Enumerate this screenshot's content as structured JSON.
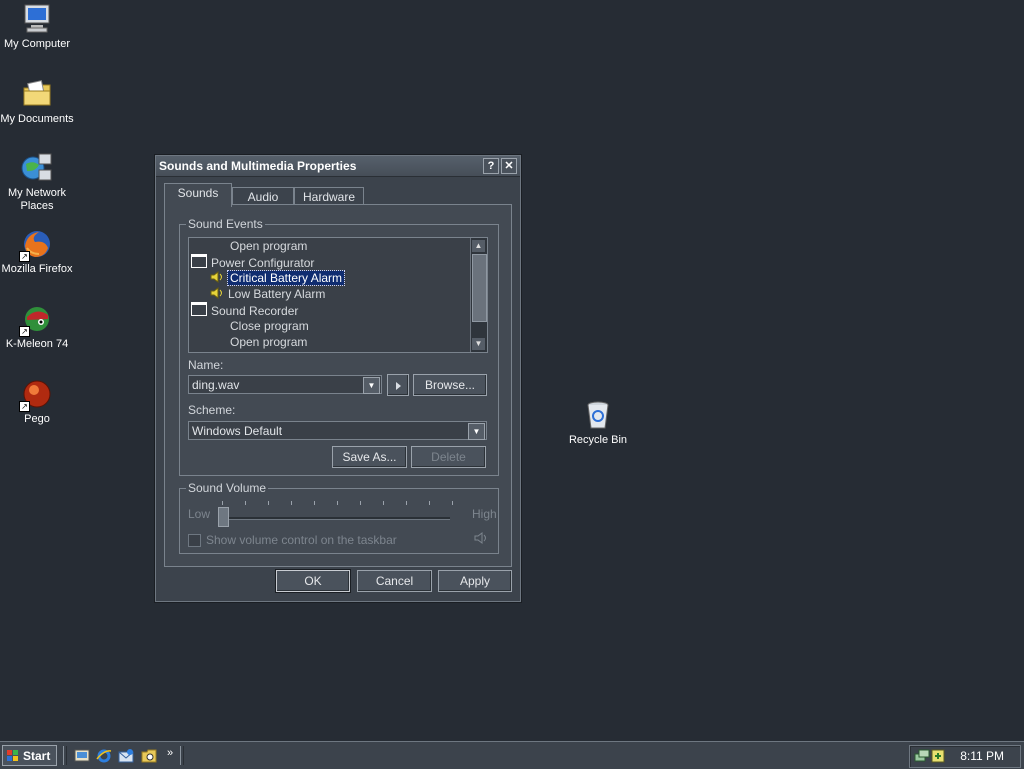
{
  "desktop": {
    "icons": [
      {
        "label": "My Computer"
      },
      {
        "label": "My Documents"
      },
      {
        "label": "My Network Places"
      },
      {
        "label": "Mozilla Firefox"
      },
      {
        "label": "K-Meleon 74"
      },
      {
        "label": "Pego"
      },
      {
        "label": "Recycle Bin"
      }
    ]
  },
  "dialog": {
    "title": "Sounds and Multimedia Properties",
    "help_glyph": "?",
    "close_glyph": "✕",
    "tabs": [
      "Sounds",
      "Audio",
      "Hardware"
    ],
    "active_tab": "Sounds",
    "sound_events": {
      "legend": "Sound Events",
      "items": [
        {
          "label": "Open program",
          "level": 1,
          "icon": "none"
        },
        {
          "label": "Power Configurator",
          "level": 0,
          "icon": "window-icon"
        },
        {
          "label": "Critical Battery Alarm",
          "level": 1,
          "icon": "speaker-icon",
          "selected": true
        },
        {
          "label": "Low Battery Alarm",
          "level": 1,
          "icon": "speaker-icon"
        },
        {
          "label": "Sound Recorder",
          "level": 0,
          "icon": "window-icon"
        },
        {
          "label": "Close program",
          "level": 1,
          "icon": "none"
        },
        {
          "label": "Open program",
          "level": 1,
          "icon": "none"
        }
      ],
      "name_label": "Name:",
      "name_value": "ding.wav",
      "browse_label": "Browse...",
      "scheme_label": "Scheme:",
      "scheme_value": "Windows Default",
      "save_as_label": "Save As...",
      "delete_label": "Delete"
    },
    "sound_volume": {
      "legend": "Sound Volume",
      "low_label": "Low",
      "high_label": "High",
      "level": 0,
      "checkbox_label": "Show volume control on the taskbar",
      "checkbox_checked": false
    },
    "buttons": {
      "ok": "OK",
      "cancel": "Cancel",
      "apply": "Apply"
    }
  },
  "taskbar": {
    "start_label": "Start",
    "chevron": "»",
    "clock": "8:11 PM"
  }
}
